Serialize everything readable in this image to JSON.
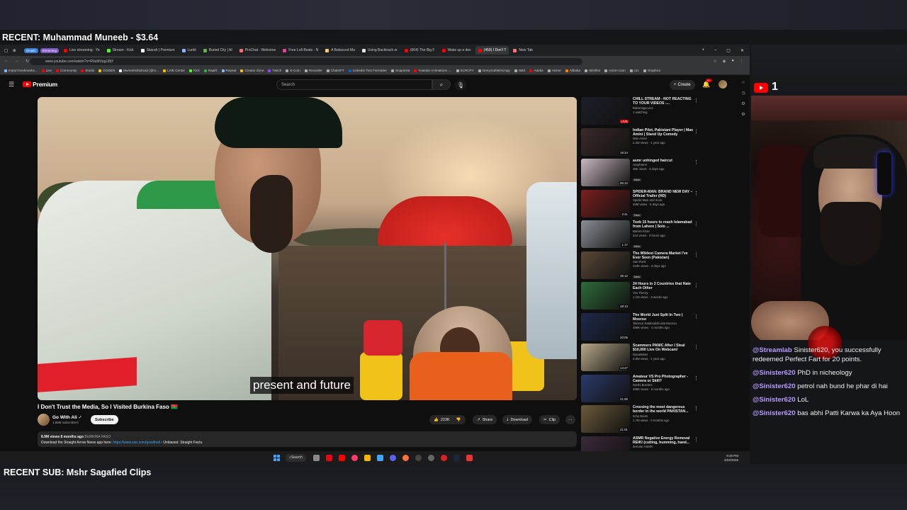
{
  "overlay": {
    "recent_donation": "RECENT: Muhammad Muneeb - $3.64",
    "recent_sub": "RECENT SUB: Mshr Sagafied Clips",
    "yt_viewer_count": "1"
  },
  "browser": {
    "pills": [
      {
        "label": "Emails",
        "color": "#3b7ddd"
      },
      {
        "label": "Streaming",
        "color": "#7e57c2"
      }
    ],
    "tabs": [
      {
        "label": "Live streaming - Yo",
        "color": "#ff0000",
        "active": false
      },
      {
        "label": "Stream - Kick",
        "color": "#53fc18",
        "active": false
      },
      {
        "label": "Sitarah | Premium",
        "color": "#ffffff",
        "active": false
      },
      {
        "label": "Lurkit",
        "color": "#8fb3ff",
        "active": false
      },
      {
        "label": "Buried City | AI",
        "color": "#6ab04c",
        "active": false
      },
      {
        "label": "ProChat - Welcome",
        "color": "#ff6b6b",
        "active": false
      },
      {
        "label": "Free Lofi Beats - N",
        "color": "#e84393",
        "active": false
      },
      {
        "label": "A Balanced Ma",
        "color": "#fdcb6e",
        "active": false
      },
      {
        "label": "Using Backtrack or",
        "color": "#dfe6e9",
        "active": false
      },
      {
        "label": "(664) The Big F",
        "color": "#ff0000",
        "active": false
      },
      {
        "label": "Wake up a dev",
        "color": "#ff0000",
        "active": false
      },
      {
        "label": "(459) I Don't T",
        "color": "#ff0000",
        "active": true
      },
      {
        "label": "New Tab",
        "color": "#ff7675",
        "active": false
      }
    ],
    "url": "www.youtube.com/watch?v=R0uMVpgU8jY",
    "bookmarks": [
      {
        "label": "Import bookmarks...",
        "color": "#8ab4f8"
      },
      {
        "label": "Live",
        "color": "#ff0000"
      },
      {
        "label": "Community",
        "color": "#ff0000"
      },
      {
        "label": "Studio",
        "color": "#ff0000"
      },
      {
        "label": "GODEN",
        "color": "#fbbc04"
      },
      {
        "label": "MuneebShahzad (@m...",
        "color": "#ffffff"
      },
      {
        "label": "LIVE Center",
        "color": "#fbbc04"
      },
      {
        "label": "Kick",
        "color": "#53fc18"
      },
      {
        "label": "RapiR",
        "color": "#34a853"
      },
      {
        "label": "Repeat",
        "color": "#8ab4f8"
      },
      {
        "label": "Creator Zone",
        "color": "#fbbc04"
      },
      {
        "label": "Twitch",
        "color": "#9146ff"
      },
      {
        "label": "E-Com",
        "color": "#aaaaaa"
      },
      {
        "label": "Recorder",
        "color": "#aaaaaa"
      },
      {
        "label": "ChatGPT",
        "color": "#aaaaaa"
      },
      {
        "label": "LinkedIn Text Formatter",
        "color": "#0a66c2"
      },
      {
        "label": "Snapinsta",
        "color": "#aaaaaa"
      },
      {
        "label": "Youtube Animations -...",
        "color": "#ff0000"
      },
      {
        "label": "SCRCPY",
        "color": "#aaaaaa"
      },
      {
        "label": "Genymobile/scrcpy",
        "color": "#aaaaaa"
      },
      {
        "label": "OBS",
        "color": "#aaaaaa"
      },
      {
        "label": "Adobe",
        "color": "#ff0000"
      },
      {
        "label": "Anime",
        "color": "#aaaaaa"
      },
      {
        "label": "Alibaba",
        "color": "#ff7a00"
      },
      {
        "label": "Wishlist",
        "color": "#aaaaaa"
      },
      {
        "label": "Action Cam",
        "color": "#aaaaaa"
      },
      {
        "label": "c2c",
        "color": "#aaaaaa"
      },
      {
        "label": "Graphics",
        "color": "#aaaaaa"
      }
    ]
  },
  "youtube": {
    "logo_label": "Premium",
    "search_placeholder": "Search",
    "create_label": "Create",
    "notif_count": "9+",
    "subtitle": "present and future",
    "video_title": "I Don't Trust the Media, So I Visited Burkina Faso 🇧🇫",
    "channel_name": "Go With Ali ✓",
    "subscribers": "1.58M subscribers",
    "subscribe_label": "Subscribe",
    "actions": {
      "likes": "223K",
      "share": "Share",
      "download": "Download",
      "clip": "Clip"
    },
    "description": {
      "meta": "8.9M views  8 months ago",
      "tag": "BURKINA FASO",
      "line_prefix": "Download the Straight Arrow News app here:",
      "link": "https://www.san.com/gowithali",
      "line_suffix": " - Unbiased. Straight Facts."
    },
    "recommendations": [
      {
        "title": "CHILL STREAM - NOT REACTING TO YOUR VIDEOS -...",
        "channel": "BabaYaga Live",
        "meta": "1 watching",
        "duration": "LIVE",
        "live": true,
        "thumb": "#1e1e2a",
        "badge": ""
      },
      {
        "title": "Indian Pilot, Pakistani Player | Max Amini | Stand Up Comedy",
        "channel": "Max Amini",
        "meta": "2.3M views · 1 year ago",
        "duration": "16:24",
        "live": false,
        "thumb": "#3b2a2a",
        "badge": ""
      },
      {
        "title": "asmr unhinged haircut",
        "channel": "zaspharrel",
        "meta": "35K views · 6 days ago",
        "duration": "26:12",
        "live": false,
        "thumb": "#c9b8c0",
        "badge": "New"
      },
      {
        "title": "SPIDER-MAN: BRAND NEW DAY – Official Trailer (HD)",
        "channel": "Spider-Man and more",
        "meta": "26M views · 5 days ago",
        "duration": "2:41",
        "live": false,
        "thumb": "#7a1f1f",
        "badge": "New"
      },
      {
        "title": "Took 15 hours to reach Islamabad from Lahore | Solo ...",
        "channel": "Bamra Khan",
        "meta": "244 views · 3 hours ago",
        "duration": "1:17",
        "live": false,
        "thumb": "#8a8f96",
        "badge": "New"
      },
      {
        "title": "The Wildest Camera Market I've Ever Seen (Pakistan)",
        "channel": "Sari Rock",
        "meta": "218K views · 3 days ago",
        "duration": "36:12",
        "live": false,
        "thumb": "#5a4838",
        "badge": "New"
      },
      {
        "title": "24 Hours in 2 Countries that Hate Each Other",
        "channel": "Yes Theory",
        "meta": "1.1M views · 3 weeks ago",
        "duration": "48:13",
        "live": false,
        "thumb": "#2f6a3a",
        "badge": ""
      },
      {
        "title": "The World Just Split In Two | Mooroo",
        "channel": "Taimoor Salahuddin aka Mooroo",
        "meta": "486K views · 4 months ago",
        "duration": "20:05",
        "live": false,
        "thumb": "#1f2a4a",
        "badge": ""
      },
      {
        "title": "Scammers PANIC After I Steal $10,000 Live On Webcam!",
        "channel": "NanoBaiter",
        "meta": "4.8M views · 1 year ago",
        "duration": "14:47",
        "live": false,
        "thumb": "#b8a88a",
        "badge": ""
      },
      {
        "title": "Amateur VS Pro Photographer - Camera or Skill?",
        "channel": "Northi Borders",
        "meta": "209K views · 6 months ago",
        "duration": "21:00",
        "live": false,
        "thumb": "#2b3a6a",
        "badge": ""
      },
      {
        "title": "Crossing the most dangerous border in the world PAKISTAN...",
        "channel": "Itchy Boots",
        "meta": "1.7M views · 5 months ago",
        "duration": "21:01",
        "live": false,
        "thumb": "#6a5a3a",
        "badge": ""
      },
      {
        "title": "ASMR Negative Energy Removal REIKI (cutting, humming, hand...",
        "channel": "deKoite ASMR",
        "meta": "",
        "duration": "",
        "live": false,
        "thumb": "#3a2a3a",
        "badge": ""
      }
    ]
  },
  "taskbar": {
    "search_label": "Search",
    "time": "9:49 PM",
    "date": "3/23/2026"
  },
  "chat": [
    {
      "user": "@Streamlab",
      "msg": "Sinister620, you successfully redeemed Perfect Fart for 20 points."
    },
    {
      "user": "@Sinister620",
      "msg": "PhD in nicheology"
    },
    {
      "user": "@Sinister620",
      "msg": "petrol nah bund he phar di hai"
    },
    {
      "user": "@Sinister620",
      "msg": "LoL"
    },
    {
      "user": "@Sinister620",
      "msg": "bas abhi Patti Karwa ka Aya Hoon"
    }
  ]
}
